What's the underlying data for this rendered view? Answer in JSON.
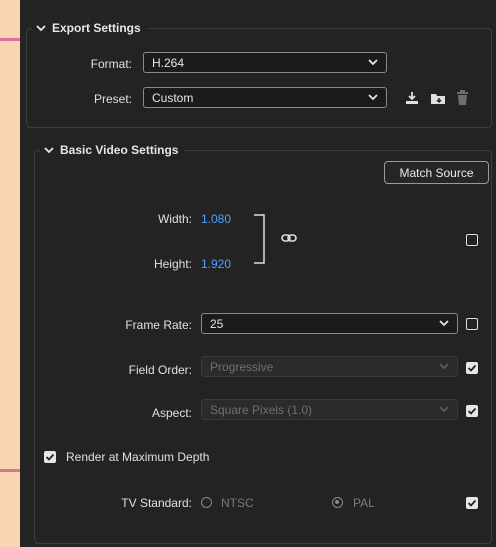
{
  "export_settings": {
    "title": "Export Settings",
    "format_label": "Format:",
    "format_value": "H.264",
    "preset_label": "Preset:",
    "preset_value": "Custom"
  },
  "basic_video": {
    "title": "Basic Video Settings",
    "match_source_label": "Match Source",
    "width_label": "Width:",
    "width_value": "1.080",
    "height_label": "Height:",
    "height_value": "1.920",
    "frame_rate_label": "Frame Rate:",
    "frame_rate_value": "25",
    "field_order_label": "Field Order:",
    "field_order_value": "Progressive",
    "aspect_label": "Aspect:",
    "aspect_value": "Square Pixels (1.0)",
    "render_max_depth_label": "Render at Maximum Depth",
    "tv_standard_label": "TV Standard:",
    "tv_options": [
      "NTSC",
      "PAL"
    ]
  },
  "colors": {
    "accent_blue": "#4ea1ff",
    "panel_bg": "#232323",
    "page_bg": "#f9d4b0"
  }
}
